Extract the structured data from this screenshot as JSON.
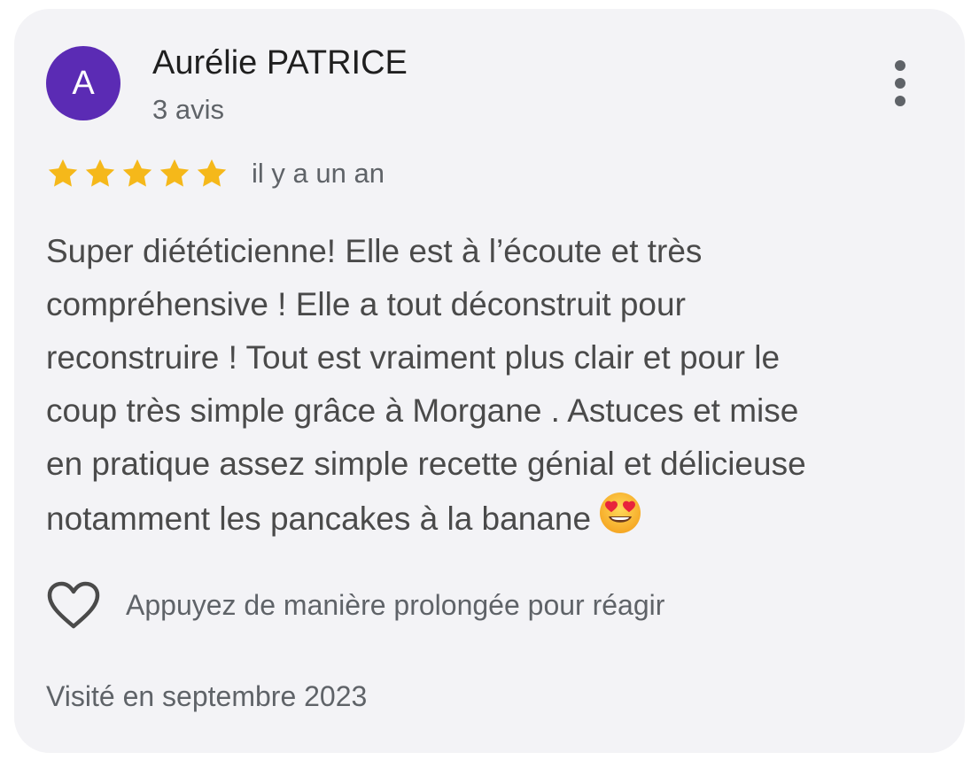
{
  "review": {
    "author": {
      "initial": "A",
      "name": "Aurélie PATRICE",
      "review_count": "3 avis",
      "avatar_color": "#5b2bb4"
    },
    "rating": {
      "stars": 5,
      "max_stars": 5,
      "star_color": "#f5b81a"
    },
    "date": "il y a un an",
    "text_lines": [
      "Super diététicienne! Elle est à l’écoute et très",
      "compréhensive ! Elle a tout déconstruit pour",
      "reconstruire ! Tout est vraiment plus clair et pour le",
      "coup très simple grâce à Morgane . Astuces et mise",
      "en pratique assez simple recette génial et délicieuse",
      "notamment les pancakes à la banane"
    ],
    "emoji_icon": "heart-eyes-emoji-icon",
    "reaction_label": "Appuyez de manière prolongée pour réagir",
    "visited": "Visité en septembre 2023"
  }
}
